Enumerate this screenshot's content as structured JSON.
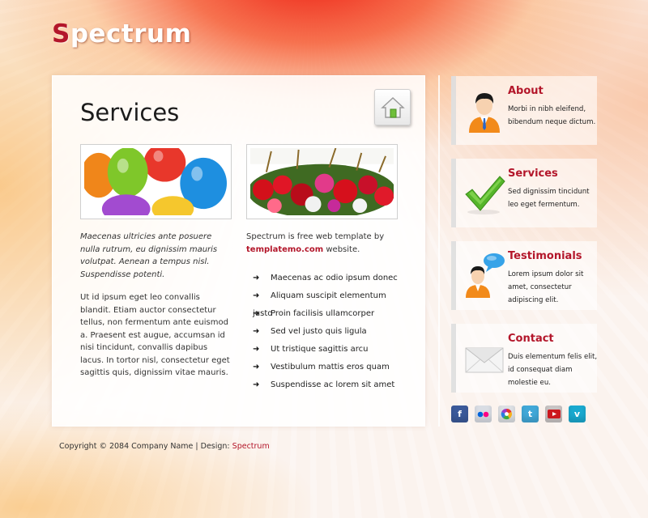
{
  "site": {
    "logo_first": "S",
    "logo_rest": "pectrum"
  },
  "main": {
    "title": "Services",
    "left_italic": "Maecenas ultricies ante posuere nulla rutrum, eu dignissim mauris volutpat. Aenean a tempus nisl. Suspendisse potenti.",
    "left_body": "Ut id ipsum eget leo convallis blandit. Etiam auctor consectetur tellus, non fermentum ante euismod a. Praesent est augue, accumsan id nisi tincidunt, convallis dapibus lacus. In tortor nisl, consectetur eget sagittis quis, dignissim vitae mauris.",
    "right_intro_before": "Spectrum is free web template by",
    "right_intro_link": "templatemo.com",
    "right_intro_after": "website.",
    "bullets": [
      "Maecenas ac odio ipsum donec",
      "Aliquam suscipit elementum justo",
      "Proin facilisis ullamcorper",
      "Sed vel justo quis ligula",
      "Ut tristique sagittis arcu",
      "Vestibulum mattis eros quam",
      "Suspendisse ac lorem sit amet"
    ]
  },
  "sidebar": {
    "about": {
      "title": "About",
      "text": "Morbi in nibh eleifend, bibendum neque dictum."
    },
    "services": {
      "title": "Services",
      "text": "Sed dignissim tincidunt leo eget fermentum."
    },
    "testimonials": {
      "title": "Testimonials",
      "text": "Lorem ipsum dolor sit amet, consectetur adipiscing elit."
    },
    "contact": {
      "title": "Contact",
      "text": "Duis elementum felis elit, id consequat diam molestie eu."
    }
  },
  "social": {
    "icons": [
      "facebook-icon",
      "flickr-icon",
      "picasa-icon",
      "twitter-icon",
      "youtube-icon",
      "vimeo-icon"
    ]
  },
  "footer": {
    "text": "Copyright © 2084 Company Name | Design:",
    "design_link": "Spectrum"
  },
  "colors": {
    "accent": "#b3162a",
    "title": "#1c1c1c"
  }
}
